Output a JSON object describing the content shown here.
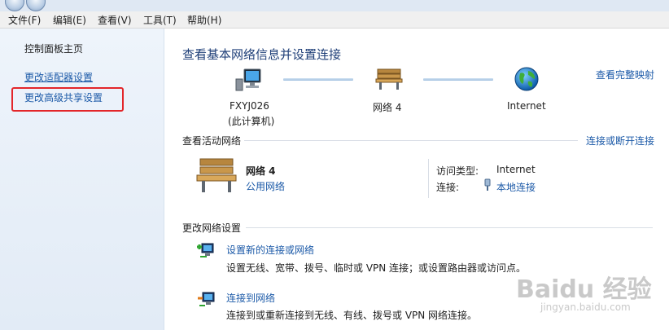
{
  "menu": {
    "file": "文件(F)",
    "edit": "编辑(E)",
    "view": "查看(V)",
    "tools": "工具(T)",
    "help": "帮助(H)"
  },
  "sidebar": {
    "home": "控制面板主页",
    "adapter": "更改适配器设置",
    "sharing": "更改高级共享设置"
  },
  "main": {
    "title": "查看基本网络信息并设置连接",
    "full_map": "查看完整映射",
    "computer_name": "FXYJ026",
    "computer_sub": "(此计算机)",
    "network_name": "网络  4",
    "internet": "Internet",
    "active_head": "查看活动网络",
    "connect_disconnect": "连接或断开连接",
    "active": {
      "name": "网络  4",
      "type_link": "公用网络",
      "access_label": "访问类型:",
      "access_value": "Internet",
      "conn_label": "连接:",
      "conn_value": "本地连接"
    },
    "change_head": "更改网络设置",
    "tasks": [
      {
        "title": "设置新的连接或网络",
        "desc": "设置无线、宽带、拨号、临时或 VPN 连接；或设置路由器或访问点。"
      },
      {
        "title": "连接到网络",
        "desc": "连接到或重新连接到无线、有线、拨号或 VPN 网络连接。"
      }
    ]
  },
  "watermark": {
    "brand": "Baidu 经验",
    "url": "jingyan.baidu.com"
  },
  "colors": {
    "link": "#1c5aa8",
    "title": "#1f3f78",
    "highlight": "#e3262a",
    "sidebar_bg": "#e7eff8"
  }
}
